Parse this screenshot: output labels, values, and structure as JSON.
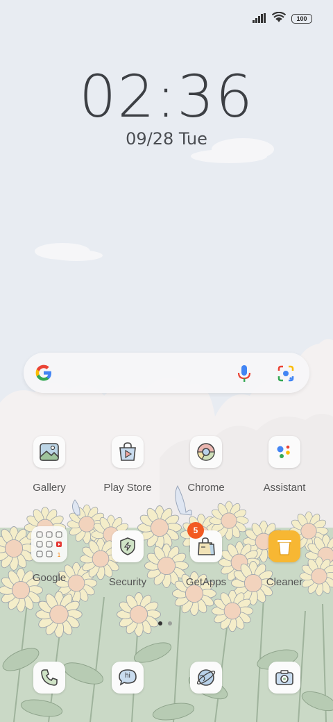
{
  "status_bar": {
    "battery": "100",
    "icons": [
      "signal-icon",
      "wifi-icon",
      "battery-icon"
    ]
  },
  "lockclock": {
    "time": "02:36",
    "date": "09/28",
    "day": "Tue"
  },
  "search": {
    "icons": [
      "google-g-icon",
      "microphone-icon",
      "google-lens-icon"
    ]
  },
  "apps_row1": [
    {
      "label": "Gallery",
      "icon": "gallery-icon"
    },
    {
      "label": "Play Store",
      "icon": "play-store-icon"
    },
    {
      "label": "Chrome",
      "icon": "chrome-icon"
    },
    {
      "label": "Assistant",
      "icon": "assistant-icon"
    }
  ],
  "apps_row2": [
    {
      "label": "Google",
      "icon": "google-folder-icon"
    },
    {
      "label": "Security",
      "icon": "security-icon"
    },
    {
      "label": "GetApps",
      "icon": "getapps-icon",
      "badge": "5"
    },
    {
      "label": "Cleaner",
      "icon": "cleaner-icon"
    }
  ],
  "dock": [
    {
      "icon": "phone-icon"
    },
    {
      "icon": "messages-icon",
      "text": "hi"
    },
    {
      "icon": "browser-icon"
    },
    {
      "icon": "camera-icon"
    }
  ],
  "colors": {
    "sky": "#e8ecf2",
    "badge": "#f25a22",
    "cleaner": "#f7b733"
  }
}
